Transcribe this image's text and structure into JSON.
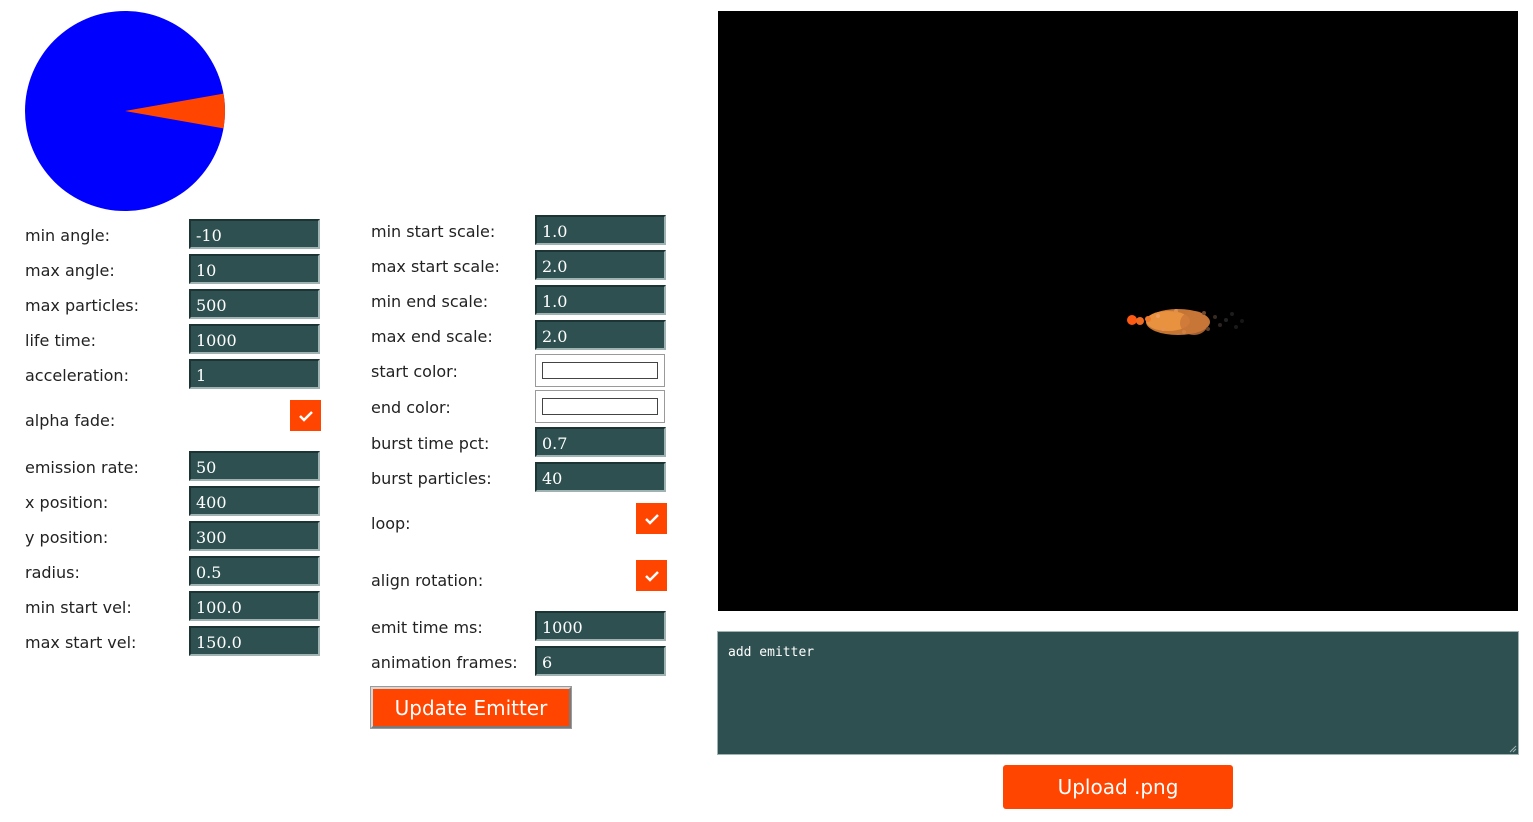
{
  "angle_preview": {
    "circle_color": "#0000ff",
    "wedge_color": "#ff4500",
    "min_angle_deg": -10,
    "max_angle_deg": 10
  },
  "left_fields": [
    {
      "label": "min angle:",
      "value": "-10"
    },
    {
      "label": "max angle:",
      "value": "10"
    },
    {
      "label": "max particles:",
      "value": "500"
    },
    {
      "label": "life time:",
      "value": "1000"
    },
    {
      "label": "acceleration:",
      "value": "1"
    }
  ],
  "alpha_fade": {
    "label": "alpha fade:",
    "checked": true
  },
  "left_fields_2": [
    {
      "label": "emission rate:",
      "value": "50"
    },
    {
      "label": "x position:",
      "value": "400"
    },
    {
      "label": "y position:",
      "value": "300"
    },
    {
      "label": "radius:",
      "value": "0.5"
    },
    {
      "label": "min start vel:",
      "value": "100.0"
    },
    {
      "label": "max start vel:",
      "value": "150.0"
    }
  ],
  "mid_fields": [
    {
      "label": "min start scale:",
      "value": "1.0"
    },
    {
      "label": "max start scale:",
      "value": "2.0"
    },
    {
      "label": "min end scale:",
      "value": "1.0"
    },
    {
      "label": "max end scale:",
      "value": "2.0"
    }
  ],
  "color_fields": [
    {
      "label": "start color:",
      "value": "#ffffff"
    },
    {
      "label": "end color:",
      "value": "#ffffff"
    }
  ],
  "mid_fields_2": [
    {
      "label": "burst time pct:",
      "value": "0.7"
    },
    {
      "label": "burst particles:",
      "value": "40"
    }
  ],
  "loop": {
    "label": "loop:",
    "checked": true
  },
  "align_rotation": {
    "label": "align rotation:",
    "checked": true
  },
  "mid_fields_3": [
    {
      "label": "emit time ms:",
      "value": "1000"
    },
    {
      "label": "animation frames:",
      "value": "6"
    }
  ],
  "update_button": "Update Emitter",
  "console_text": "add emitter",
  "upload_button": "Upload .png",
  "colors": {
    "accent": "#ff4500",
    "input_bg": "#2f5050",
    "canvas_bg": "#000000"
  }
}
